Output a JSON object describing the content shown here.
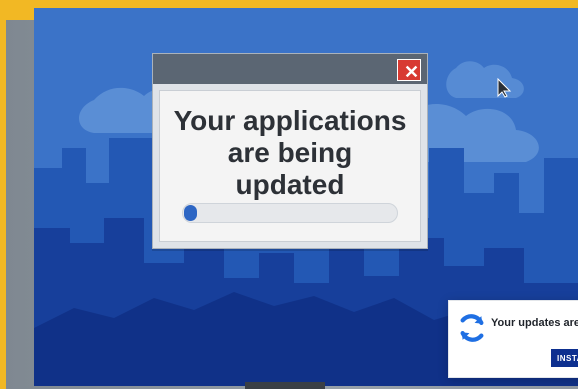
{
  "colors": {
    "background_yellow": "#f2b824",
    "screen_blue": "#2f66bf",
    "city_light_blue": "#5c8fd6",
    "city_mid_blue": "#1d4ea8",
    "popup_titlebar": "#5b6673",
    "close_red": "#d83a32",
    "progress_blue": "#2d66c4",
    "install_button": "#0d2f8f"
  },
  "dialog": {
    "title_line_1": "Your applications",
    "title_line_2": "are being updated",
    "close_icon": "close-icon",
    "progress": 0.06
  },
  "toast": {
    "icon": "refresh-icon",
    "message": "Your updates are ready",
    "install_label": "INSTALL"
  },
  "cursor": {
    "icon": "mouse-pointer-icon"
  }
}
